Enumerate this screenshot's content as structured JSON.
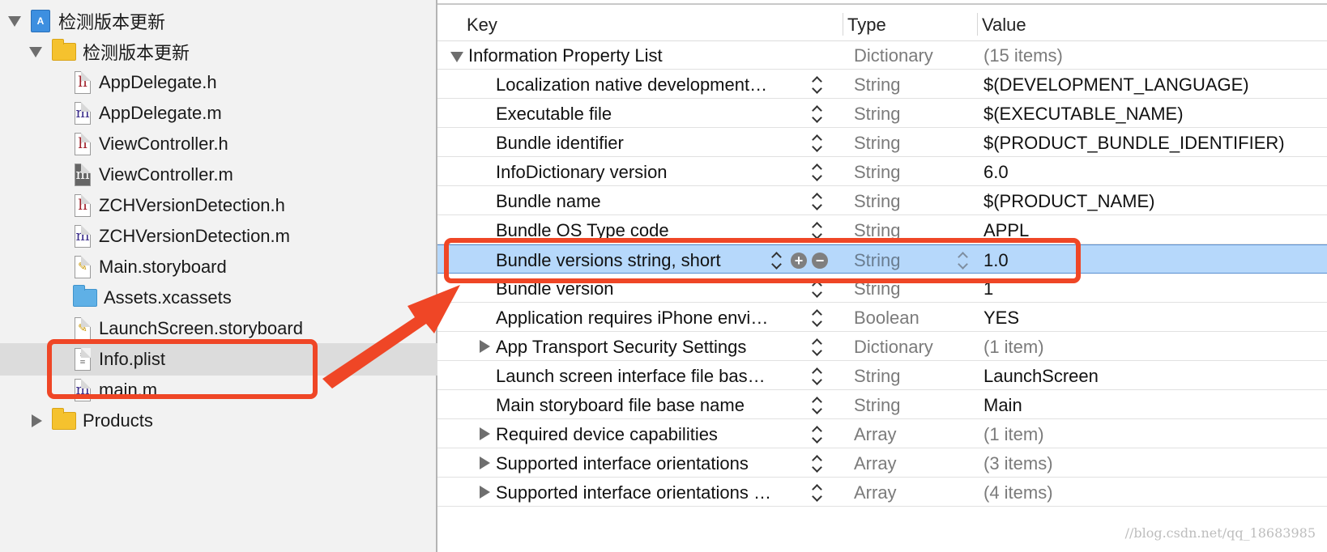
{
  "navigator": {
    "items": [
      {
        "label": "检测版本更新",
        "icon": "xcode-project-icon",
        "disclosure": "expanded"
      },
      {
        "label": "检测版本更新",
        "icon": "folder-icon",
        "disclosure": "expanded"
      },
      {
        "label": "AppDelegate.h",
        "icon": "header-file-icon",
        "glyph": "h"
      },
      {
        "label": "AppDelegate.m",
        "icon": "source-file-icon",
        "glyph": "m"
      },
      {
        "label": "ViewController.h",
        "icon": "header-file-icon",
        "glyph": "h"
      },
      {
        "label": "ViewController.m",
        "icon": "source-file-icon",
        "glyph": "m"
      },
      {
        "label": "ZCHVersionDetection.h",
        "icon": "header-file-icon",
        "glyph": "h"
      },
      {
        "label": "ZCHVersionDetection.m",
        "icon": "source-file-icon",
        "glyph": "m"
      },
      {
        "label": "Main.storyboard",
        "icon": "storyboard-file-icon"
      },
      {
        "label": "Assets.xcassets",
        "icon": "asset-catalog-icon"
      },
      {
        "label": "LaunchScreen.storyboard",
        "icon": "storyboard-file-icon"
      },
      {
        "label": "Info.plist",
        "icon": "plist-file-icon",
        "selected": true
      },
      {
        "label": "main.m",
        "icon": "source-file-icon",
        "glyph": "m"
      },
      {
        "label": "Products",
        "icon": "folder-icon",
        "disclosure": "collapsed"
      }
    ]
  },
  "editor": {
    "columns": {
      "key": "Key",
      "type": "Type",
      "value": "Value"
    },
    "root": {
      "key": "Information Property List",
      "type": "Dictionary",
      "value": "(15 items)"
    },
    "rows": [
      {
        "key": "Localization native development re...",
        "type": "String",
        "value": "$(DEVELOPMENT_LANGUAGE)"
      },
      {
        "key": "Executable file",
        "type": "String",
        "value": "$(EXECUTABLE_NAME)"
      },
      {
        "key": "Bundle identifier",
        "type": "String",
        "value": "$(PRODUCT_BUNDLE_IDENTIFIER)"
      },
      {
        "key": "InfoDictionary version",
        "type": "String",
        "value": "6.0"
      },
      {
        "key": "Bundle name",
        "type": "String",
        "value": "$(PRODUCT_NAME)"
      },
      {
        "key": "Bundle OS Type code",
        "type": "String",
        "value": "APPL"
      },
      {
        "key": "Bundle versions string, short",
        "type": "String",
        "value": "1.0",
        "selected": true
      },
      {
        "key": "Bundle version",
        "type": "String",
        "value": "1"
      },
      {
        "key": "Application requires iPhone enviro...",
        "type": "Boolean",
        "value": "YES"
      },
      {
        "key": "App Transport Security Settings",
        "type": "Dictionary",
        "value": "(1 item)",
        "expandable": true
      },
      {
        "key": "Launch screen interface file base...",
        "type": "String",
        "value": "LaunchScreen"
      },
      {
        "key": "Main storyboard file base name",
        "type": "String",
        "value": "Main"
      },
      {
        "key": "Required device capabilities",
        "type": "Array",
        "value": "(1 item)",
        "expandable": true
      },
      {
        "key": "Supported interface orientations",
        "type": "Array",
        "value": "(3 items)",
        "expandable": true
      },
      {
        "key": "Supported interface orientations (i...",
        "type": "Array",
        "value": "(4 items)",
        "expandable": true
      }
    ],
    "row_buttons": {
      "add": "+",
      "remove": "−"
    }
  },
  "annotations": {
    "highlight_color": "#ef4626",
    "selection_color": "#b6d8fb"
  },
  "watermark": "//blog.csdn.net/qq_18683985"
}
